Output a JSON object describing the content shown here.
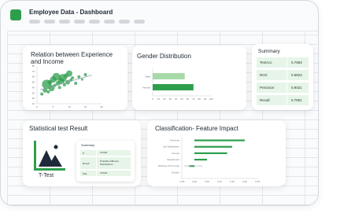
{
  "window": {
    "title": "Employee Data - Dashboard",
    "menu_pill_count": 8
  },
  "colors": {
    "accent_green": "#2e9e4c",
    "light_green": "#e6f5e8",
    "bar_light_green": "#a8d9a8",
    "dark_navy": "#1e2a3a"
  },
  "experience_card": {
    "title_line1": "Relation between Experience",
    "title_line2": "and Income"
  },
  "gender_card": {
    "title": "Gender Distribution"
  },
  "summary_card": {
    "title": "Summary",
    "rows": [
      {
        "label": "TestAcc",
        "value": "0.7683"
      },
      {
        "label": "ROC",
        "value": "0.6824"
      },
      {
        "label": "Precision",
        "value": "0.9021"
      },
      {
        "label": "Recall",
        "value": "0.7901"
      }
    ]
  },
  "stat_card": {
    "title": "Statistical test Result",
    "icon_label": "T-Test",
    "table": {
      "title": "Summary",
      "rows": [
        {
          "label": "P",
          "value": "0.0326"
        },
        {
          "label": "Result",
          "value": "Probably Different Distributions"
        },
        {
          "label": "Stat",
          "value": "2.0623"
        }
      ]
    }
  },
  "class_card": {
    "title": "Classification- Feature Impact"
  },
  "chart_data": [
    {
      "type": "scatter",
      "title": "Relation between Experience and Income",
      "xlabel": "",
      "ylabel": "",
      "x_ticks": [
        "0",
        "5",
        "10",
        "15",
        "20"
      ],
      "y_ticks": [
        "80",
        "70",
        "60",
        "50",
        "40",
        "30",
        "20",
        "10"
      ],
      "xlim": [
        0,
        20
      ],
      "ylim": [
        10,
        80
      ],
      "points": [
        {
          "x": 1.5,
          "y": 28,
          "s": 2
        },
        {
          "x": 2.5,
          "y": 35,
          "s": 3
        },
        {
          "x": 3,
          "y": 46,
          "s": 6
        },
        {
          "x": 3.5,
          "y": 32,
          "s": 2
        },
        {
          "x": 4,
          "y": 50,
          "s": 3
        },
        {
          "x": 4.5,
          "y": 39,
          "s": 4
        },
        {
          "x": 5,
          "y": 55,
          "s": 4
        },
        {
          "x": 5.5,
          "y": 44,
          "s": 2
        },
        {
          "x": 6,
          "y": 60,
          "s": 5
        },
        {
          "x": 6.5,
          "y": 48,
          "s": 3
        },
        {
          "x": 7,
          "y": 40,
          "s": 2
        },
        {
          "x": 7.5,
          "y": 52,
          "s": 4
        },
        {
          "x": 8,
          "y": 58,
          "s": 5
        },
        {
          "x": 8.5,
          "y": 45,
          "s": 2
        },
        {
          "x": 9,
          "y": 62,
          "s": 3
        },
        {
          "x": 9.5,
          "y": 50,
          "s": 3
        },
        {
          "x": 10,
          "y": 66,
          "s": 4
        },
        {
          "x": 10.5,
          "y": 54,
          "s": 2
        },
        {
          "x": 11,
          "y": 58,
          "s": 2
        },
        {
          "x": 12,
          "y": 48,
          "s": 2
        },
        {
          "x": 13,
          "y": 60,
          "s": 2
        },
        {
          "x": 14,
          "y": 55,
          "s": 1.5
        },
        {
          "x": 15,
          "y": 64,
          "s": 2
        }
      ],
      "trendline": [
        {
          "x": 1,
          "y": 36
        },
        {
          "x": 17,
          "y": 63
        }
      ]
    },
    {
      "type": "bar",
      "title": "Gender Distribution",
      "orientation": "horizontal",
      "categories": [
        "Male",
        "Female"
      ],
      "values": [
        55,
        70
      ],
      "x_ticks": [
        "0",
        "10",
        "20",
        "30",
        "40",
        "50",
        "60",
        "70",
        "80",
        "90",
        "100"
      ],
      "xlim": [
        0,
        100
      ],
      "series_colors": [
        "#a8d9a8",
        "#2e9e4c"
      ]
    },
    {
      "type": "bar",
      "title": "Classification- Feature Impact",
      "orientation": "horizontal",
      "categories": [
        "Overtime",
        "Job Satisfaction",
        "Income",
        "Department",
        "Distance from home",
        "Gender"
      ],
      "values": [
        0.2,
        0.15,
        0.13,
        0.05,
        -0.02,
        0.0
      ],
      "x_ticks": [
        "-0.05",
        "0.00",
        "0.05",
        "0.10",
        "0.15",
        "0.20",
        "0.25"
      ],
      "xlim": [
        -0.05,
        0.25
      ],
      "annotation": "Distance from home",
      "series_colors": [
        "#2e9e4c"
      ]
    }
  ]
}
